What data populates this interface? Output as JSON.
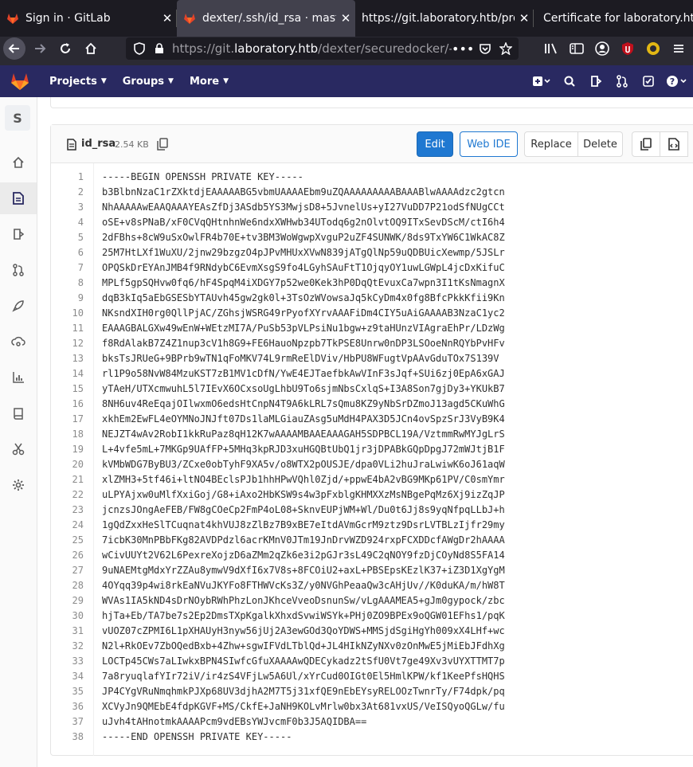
{
  "browser": {
    "tabs": [
      {
        "title": "Sign in · GitLab",
        "active": false
      },
      {
        "title": "dexter/.ssh/id_rsa · master",
        "active": true
      },
      {
        "title": "https://git.laboratory.htb/pro",
        "active": false
      },
      {
        "title": "Certificate for laboratory.htb",
        "active": false
      }
    ],
    "url_prefix": "https://git.",
    "url_domain": "laboratory.htb",
    "url_rest": "/dexter/securedocker/-/bl"
  },
  "gitlab": {
    "menus": [
      "Projects",
      "Groups",
      "More"
    ],
    "sidebar_avatar": "S"
  },
  "file": {
    "name": "id_rsa",
    "size": "2.54 KB",
    "buttons": {
      "edit": "Edit",
      "webide": "Web IDE",
      "replace": "Replace",
      "delete": "Delete"
    },
    "lines": [
      "-----BEGIN OPENSSH PRIVATE KEY-----",
      "b3BlbnNzaC1rZXktdjEAAAAABG5vbmUAAAAEbm9uZQAAAAAAAAABAAABlwAAAAdzc2gtcn",
      "NhAAAAAwEAAQAAAYEAsZfDj3ASdb5YS3MwjsD8+5JvnelUs+yI27VuDD7P21odSfNUgCCt",
      "oSE+v8sPNaB/xF0CVqQHtnhnWe6ndxXWHwb34UTodq6g2nOlvtOQ9ITxSevDScM/ctI6h4",
      "2dFBhs+8cW9uSxOwlFR4b70E+tv3BM3WoWgwpXvguP2uZF4SUNWK/8ds9TxYW6C1WkAC8Z",
      "25M7HtLXf1WuXU/2jnw29bzgzO4pJPvMHUxXVwN839jATgQlNp59uQDBUicXewmp/5JSLr",
      "OPQSkDrEYAnJMB4f9RNdybC6EvmXsgS9fo4LGyhSAuFtT1OjqyOY1uwLGWpL4jcDxKifuC",
      "MPLf5gpSQHvw0fq6/hF4SpqM4iXDGY7p52we0Kek3hP0DqQtEvuxCa7wpn3I1tKsNmagnX",
      "dqB3kIq5aEbGSESbYTAUvh45gw2gk0l+3TsOzWVowsaJq5kCyDm4x0fg8BfcPkkKfii9Kn",
      "NKsndXIH0rg0QllPjAC/ZGhsjWSRG49rPyofXYrvAAAFiDm4CIY5uAiGAAAAB3NzaC1yc2",
      "EAAAGBALGXw49wEnW+WEtzMI7A/PuSb53pVLPsiNu1bgw+z9taHUnzVIAgraEhPr/LDzWg",
      "f8RdAlakB7Z4Z1nup3cV1h8G9+FE6HauoNpzpb7TkPSE8Unrw0nDP3LSOoeNnRQYbPvHFv",
      "bksTsJRUeG+9BPrb9wTN1qFoMKV74L9rmReElDViv/HbPU8WFugtVpAAvGduTOx7S139V",
      "rl1P9o58NvW84MzuKST7zB1MV1cDfN/YwE4EJTaefbkAwVInF3sJqf+SUi6zj0EpA6xGAJ",
      "yTAeH/UTXcmwuhL5l7IEvX6OCxsoUgLhbU9To6sjmNbsCxlqS+I3A8Son7gjDy3+YKUkB7",
      "8NH6uv4ReEqajOIlwxmO6edsHtCnpN4T9A6kLRL7sQmu8KZ9yNbSrDZmoJ13agd5CKuWhG",
      "xkhEm2EwFL4eOYMNoJNJft07Ds1laMLGiauZAsg5uMdH4PAX3D5JCn4ovSpzSrJ3VyB9K4",
      "NEJZT4wAv2RobI1kkRuPaz8qH12K7wAAAAMBAAEAAAGAH5SDPBCL19A/VztmmRwMYJgLrS",
      "L+4vfe5mL+7MKGp9UAfFP+5MHq3kpRJD3xuHGQBtUbQ1jr3jDPABkGQpDpgJ72mWJtjB1F",
      "kVMbWDG7ByBU3/ZCxe0obTyhF9XA5v/o8WTX2pOUSJE/dpa0VLi2huJraLwiwK6oJ61aqW",
      "xlZMH3+5tf46i+ltNO4BEclsPJb1hhHPwVQhl0Zjd/+ppwE4bA2vBG9MKp61PV/C0smYmr",
      "uLPYAjxw0uMlfXxiGoj/G8+iAxo2HbKSW9s4w3pFxblgKHMXXzMsNBgePqMz6Xj9izZqJP",
      "jcnzsJOngAeFEB/FW8gCOeCp2FmP4oL08+SknvEUPjWM+Wl/Du0t6Jj8s9yqNfpqLLbJ+h",
      "1gQdZxxHeSlTCuqnat4khVUJ8zZlBz7B9xBE7eItdAVmGcrM9ztz9DsrLVTBLzIjfr29my",
      "7icbK30MnPBbFKg82AVDPdzl6acrKMnV0JTm19JnDrvWZD924rxpFCXDDcfAWgDr2hAAAA",
      "wCivUUYt2V62L6PexreXojzD6aZMm2qZk6e3i2pGJr3sL49C2qNOY9fzDjCOyNd8S5FA14",
      "9uNAEMtgMdxYrZZAu8ymwV9dXfI6x7V8s+8FCOiU2+axL+PBSEpsKEzlK37+iZ3D1XgYgM",
      "4OYqq39p4wi8rkEaNVuJKYFo8FTHWVcKs3Z/y0NVGhPeaaQw3cAHjUv//K0duKA/m/hW8T",
      "WVAs1IA5kND4sDrNOybRWhPhzLonJKhceVveoDsnunSw/vLgAAAMEA5+gJm0gypock/zbc",
      "hjTa+Eb/TA7be7s2Ep2DmsTXpKgalkXhxdSvwiWSYk+PHj0ZO9BPEx9oQGW01EFhs1/pqK",
      "vUOZ07cZPMI6L1pXHAUyH3nyw56jUj2A3ewGOd3QoYDWS+MMSjdSgiHgYh009xX4LHf+wc",
      "N2l+RkOEv7ZbOQedBxb+4Zhw+sgwIFVdLTblQd+JL4HIkNZyNXv0zOnMwE5jMiEbJFdhXg",
      "LOCTp45CWs7aLIwkxBPN4SIwfcGfuXAAAAwQDECykadz2tSfU0Vt7ge49Xv3vUYXTTMT7p",
      "7a8ryuqlafYIr72iV/ir4zS4VFjLw5A6Ul/xYrCud0OIGt0El5HmlKPW/kf1KeePfsHQHS",
      "JP4CYgVRuNmqhmkPJXp68UV3djhA2M7T5j31xfQE9nEbEYsyRELOOzTwnrTy/F74dpk/pq",
      "XCVyJn9QMEbE4fdpKGVF+MS/CkfE+JaNH9KOLvMrlw0bx3At681vxUS/VeISQyoQGLw/fu",
      "uJvh4tAHnotmkAAAAPcm9vdEBsYWJvcmF0b3J5AQIDBA==",
      "-----END OPENSSH PRIVATE KEY-----"
    ]
  },
  "colors": {
    "gitlab_header": "#292961",
    "primary": "#1f78d1",
    "browser_dark": "#1c1b22"
  }
}
